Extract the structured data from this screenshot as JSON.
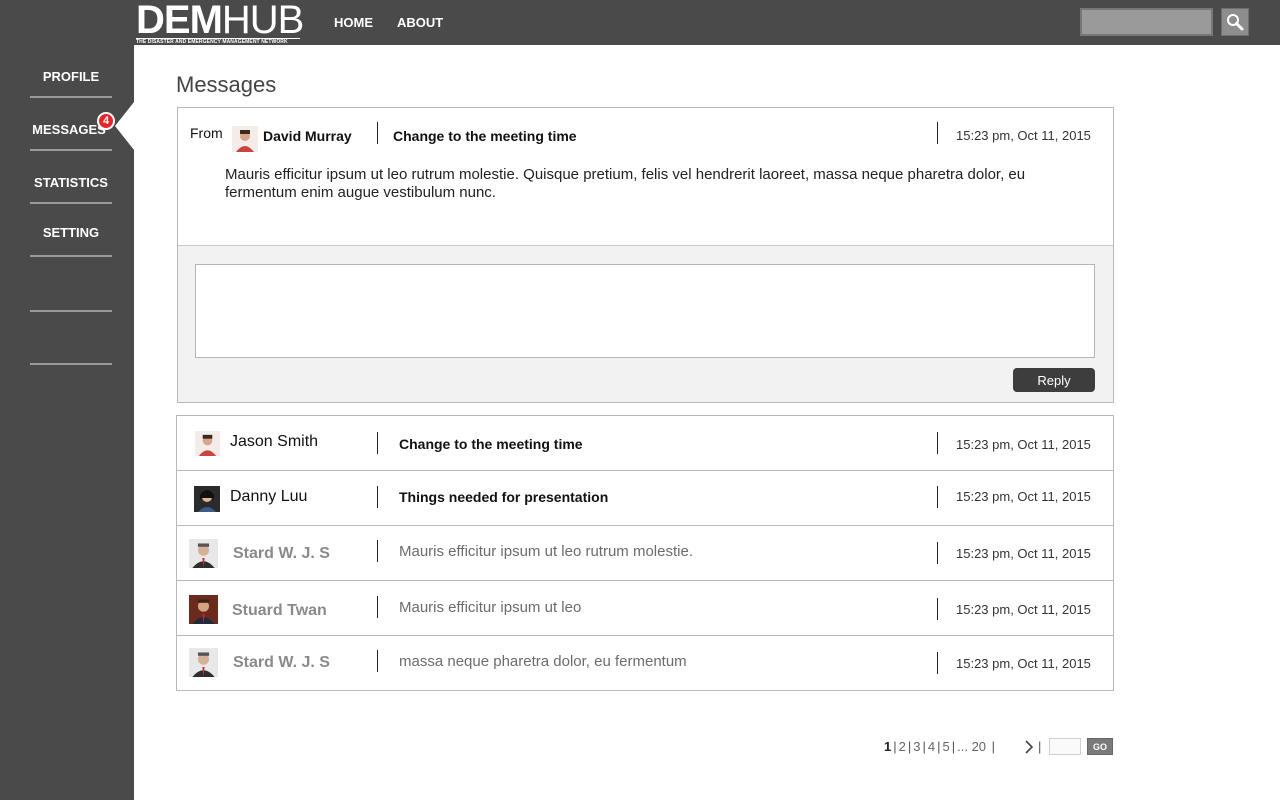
{
  "brand": {
    "logo_bold": "DEM",
    "logo_light": "HUB",
    "tagline": "THE DISASTER AND EMERGENCY MANAGEMENT NETWORK"
  },
  "nav": {
    "home": "HOME",
    "about": "ABOUT"
  },
  "search": {
    "placeholder": "",
    "icon": "search-icon"
  },
  "sidebar": {
    "items": [
      {
        "label": "PROFILE"
      },
      {
        "label": "MESSAGES",
        "badge": "4",
        "active": true
      },
      {
        "label": "STATISTICS"
      },
      {
        "label": "SETTING"
      }
    ]
  },
  "page": {
    "title": "Messages"
  },
  "open_message": {
    "from_label": "From",
    "sender": "David Murray",
    "subject": "Change to the meeting time",
    "datetime": "15:23 pm, Oct 11, 2015",
    "body": "Mauris efficitur ipsum ut leo rutrum molestie. Quisque pretium, felis vel hendrerit laoreet, massa neque pharetra dolor, eu fermentum enim augue vestibulum nunc.",
    "reply_value": "",
    "reply_button": "Reply"
  },
  "messages": [
    {
      "sender": "Jason Smith",
      "subject": "Change to the meeting time",
      "datetime": "15:23 pm, Oct 11, 2015",
      "read": false
    },
    {
      "sender": "Danny Luu",
      "subject": "Things needed for presentation",
      "datetime": "15:23 pm, Oct 11, 2015",
      "read": false
    },
    {
      "sender": "Stard W. J. S",
      "subject": "Mauris efficitur ipsum ut leo rutrum molestie.",
      "datetime": "15:23 pm, Oct 11, 2015",
      "read": true
    },
    {
      "sender": "Stuard Twan",
      "subject": "Mauris efficitur ipsum ut leo",
      "datetime": "15:23 pm, Oct 11, 2015",
      "read": true
    },
    {
      "sender": "Stard W. J. S",
      "subject": "massa neque pharetra dolor, eu fermentum",
      "datetime": "15:23 pm, Oct 11, 2015",
      "read": true
    }
  ],
  "pagination": {
    "pages": [
      "1",
      "2",
      "3",
      "4",
      "5",
      "... 20"
    ],
    "current": "1",
    "go_label": "GO",
    "page_input_value": ""
  },
  "colors": {
    "chrome": "#4a4a4a",
    "badge": "#e4262b",
    "reply_button": "#3d3d3d"
  }
}
